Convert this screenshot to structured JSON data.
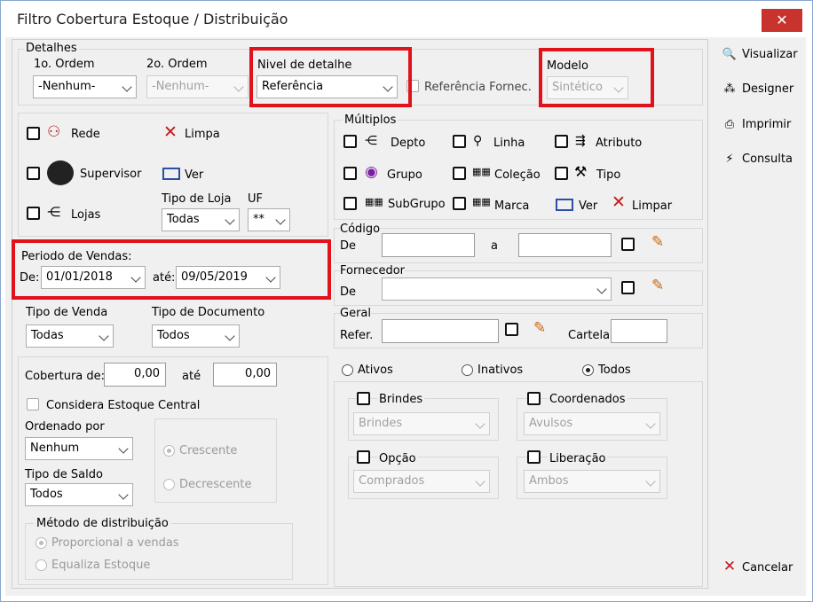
{
  "window": {
    "title": "Filtro Cobertura Estoque / Distribuição"
  },
  "detalhes": {
    "group_label": "Detalhes",
    "ordem1_label": "1o. Ordem",
    "ordem1_value": "-Nenhum-",
    "ordem2_label": "2o. Ordem",
    "ordem2_value": "-Nenhum-",
    "nivel_label": "Nivel de detalhe",
    "nivel_value": "Referência",
    "ref_fornec_label": "Referência Fornec.",
    "modelo_label": "Modelo",
    "modelo_value": "Sintético"
  },
  "left": {
    "rede": "Rede",
    "limpa": "Limpa",
    "supervisor": "Supervisor",
    "ver": "Ver",
    "tipo_loja_label": "Tipo de Loja",
    "tipo_loja_value": "Todas",
    "uf_label": "UF",
    "uf_value": "**",
    "lojas": "Lojas",
    "periodo_label": "Periodo de Vendas:",
    "de_label": "De:",
    "de_value": "01/01/2018",
    "ate_label": "até:",
    "ate_value": "09/05/2019",
    "tipo_venda_label": "Tipo de Venda",
    "tipo_venda_value": "Todas",
    "tipo_doc_label": "Tipo de Documento",
    "tipo_doc_value": "Todos",
    "cobertura_label": "Cobertura de:",
    "cobertura_de": "0,00",
    "cobertura_ate_label": "até",
    "cobertura_ate": "0,00",
    "considera": "Considera Estoque Central",
    "ordenado_label": "Ordenado por",
    "ordenado_value": "Nenhum",
    "crescente": "Crescente",
    "decrescente": "Decrescente",
    "tipo_saldo_label": "Tipo de Saldo",
    "tipo_saldo_value": "Todos",
    "metodo_label": "Método de distribuição",
    "proporcional": "Proporcional a vendas",
    "equaliza": "Equaliza Estoque"
  },
  "multiplos": {
    "label": "Múltiplos",
    "depto": "Depto",
    "linha": "Linha",
    "atributo": "Atributo",
    "grupo": "Grupo",
    "colecao": "Coleção",
    "tipo": "Tipo",
    "subgrupo": "SubGrupo",
    "marca": "Marca",
    "ver": "Ver",
    "limpar": "Limpar"
  },
  "codigo": {
    "label": "Código",
    "de": "De",
    "a": "a"
  },
  "fornecedor": {
    "label": "Fornecedor",
    "de": "De"
  },
  "geral": {
    "label": "Geral",
    "refer": "Refer.",
    "cartela": "Cartela"
  },
  "status": {
    "ativos": "Ativos",
    "inativos": "Inativos",
    "todos": "Todos"
  },
  "brindes": {
    "label": "Brindes",
    "value": "Brindes"
  },
  "coordenados": {
    "label": "Coordenados",
    "value": "Avulsos"
  },
  "opcao": {
    "label": "Opção",
    "value": "Comprados"
  },
  "liberacao": {
    "label": "Liberação",
    "value": "Ambos"
  },
  "side": {
    "visualizar": "Visualizar",
    "designer": "Designer",
    "imprimir": "Imprimir",
    "consulta": "Consulta",
    "cancelar": "Cancelar"
  }
}
